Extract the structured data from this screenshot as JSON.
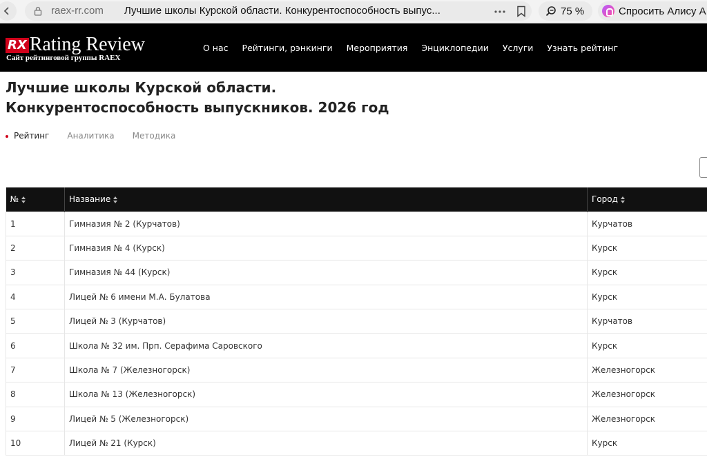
{
  "browser": {
    "domain": "raex-rr.com",
    "tab_title": "Лучшие школы Курской области. Конкурентоспособность выпус...",
    "zoom": "75 %",
    "alisa_label": "Спросить Алису А"
  },
  "site": {
    "logo_rx": "RX",
    "logo_name": "Rating Review",
    "logo_sub": "Сайт рейтинговой группы RAEX",
    "nav": [
      "О нас",
      "Рейтинги, рэнкинги",
      "Мероприятия",
      "Энциклопедии",
      "Услуги",
      "Узнать рейтинг"
    ]
  },
  "page": {
    "title_line1": "Лучшие школы Курской области.",
    "title_line2": "Конкурентоспособность выпускников. 2026 год",
    "tabs": [
      "Рейтинг",
      "Аналитика",
      "Методика"
    ]
  },
  "table": {
    "headers": [
      "№",
      "Название",
      "Город"
    ],
    "rows": [
      [
        "1",
        "Гимназия № 2 (Курчатов)",
        "Курчатов"
      ],
      [
        "2",
        "Гимназия № 4 (Курск)",
        "Курск"
      ],
      [
        "3",
        "Гимназия № 44 (Курск)",
        "Курск"
      ],
      [
        "4",
        "Лицей № 6 имени М.А. Булатова",
        "Курск"
      ],
      [
        "5",
        "Лицей № 3 (Курчатов)",
        "Курчатов"
      ],
      [
        "6",
        "Школа № 32 им. Прп. Серафима Саровского",
        "Курск"
      ],
      [
        "7",
        "Школа № 7 (Железногорск)",
        "Железногорск"
      ],
      [
        "8",
        "Школа № 13 (Железногорск)",
        "Железногорск"
      ],
      [
        "9",
        "Лицей № 5 (Железногорск)",
        "Железногорск"
      ],
      [
        "10",
        "Лицей № 21 (Курск)",
        "Курск"
      ]
    ]
  },
  "colors": {
    "accent": "#d0021b",
    "header_bg": "#000000"
  }
}
